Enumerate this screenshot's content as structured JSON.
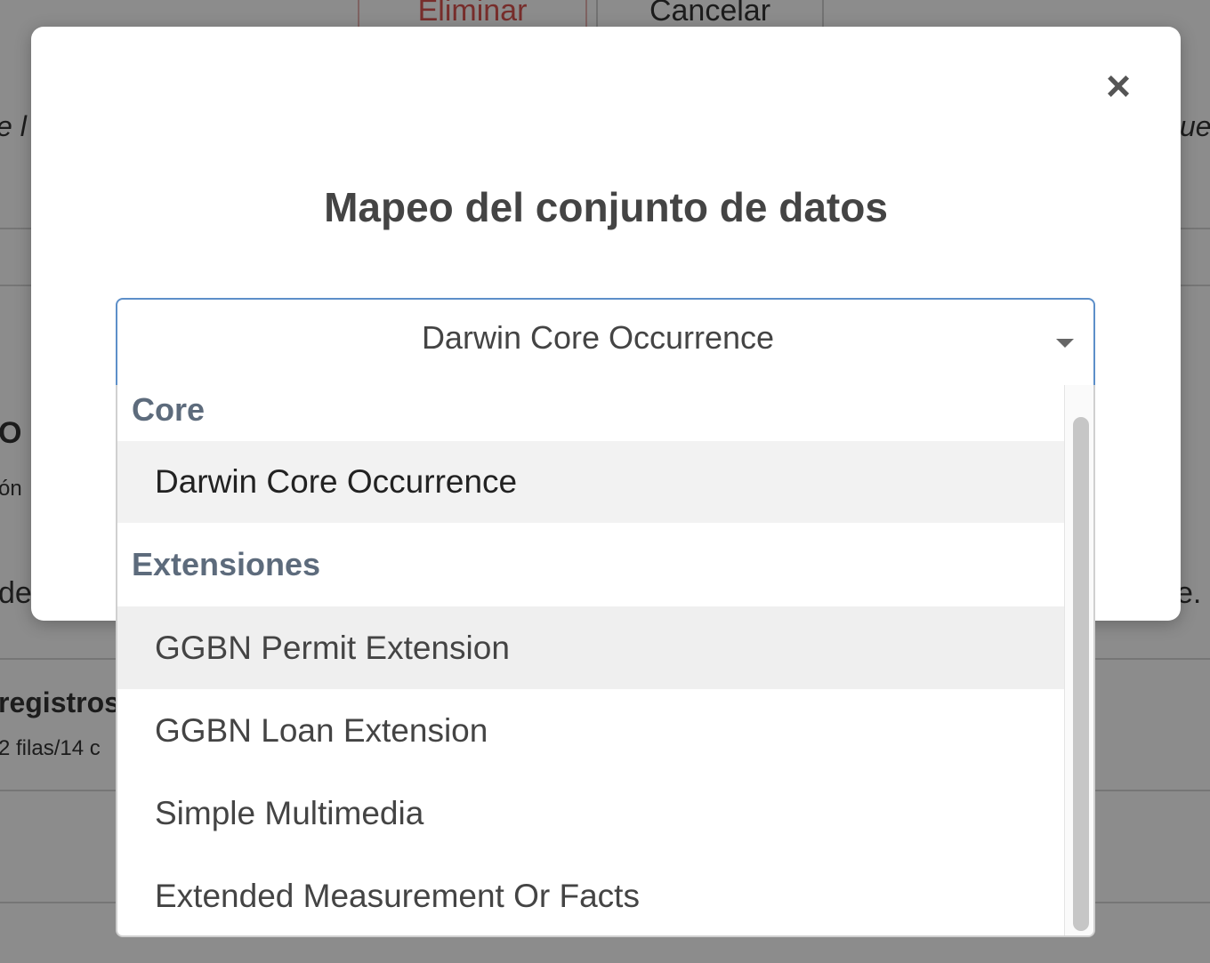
{
  "background": {
    "delete_label": "Eliminar",
    "cancel_label": "Cancelar",
    "left_fragment_1": "e l",
    "right_fragment_1": "ue",
    "left_fragment_2": "O",
    "left_fragment_3": "ón",
    "left_fragment_4": "de",
    "right_fragment_4": "e.",
    "records_label": "registros",
    "records_sub": "2 filas/14 c"
  },
  "modal": {
    "title": "Mapeo del conjunto de datos",
    "close_glyph": "×"
  },
  "select": {
    "selected_value": "Darwin Core Occurrence",
    "groups": [
      {
        "label": "Core",
        "options": [
          {
            "label": "Darwin Core Occurrence",
            "selected": true
          }
        ]
      },
      {
        "label": "Extensiones",
        "options": [
          {
            "label": "GGBN Permit Extension",
            "hover": true
          },
          {
            "label": "GGBN Loan Extension"
          },
          {
            "label": "Simple Multimedia"
          },
          {
            "label": "Extended Measurement Or Facts"
          }
        ]
      }
    ]
  },
  "colors": {
    "accent_border": "#5d8fc9",
    "danger": "#d9534f",
    "group_label": "#5d6b7c"
  }
}
